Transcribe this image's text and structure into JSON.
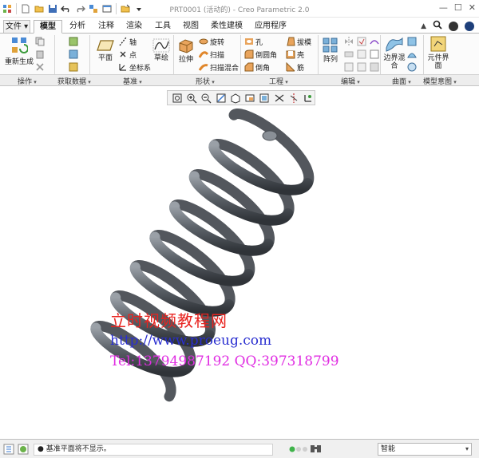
{
  "window": {
    "title": "PRT0001 (活动的) - Creo Parametric 2.0"
  },
  "quick_access": {
    "icons": [
      "new-icon",
      "open-icon",
      "save-icon",
      "undo-icon",
      "redo-icon",
      "regenerate-icon",
      "windows-icon",
      "close-window-icon",
      "customize-icon"
    ]
  },
  "tabs": [
    {
      "label": "文件 ▾"
    },
    {
      "label": "模型"
    },
    {
      "label": "分析"
    },
    {
      "label": "注释"
    },
    {
      "label": "渲染"
    },
    {
      "label": "工具"
    },
    {
      "label": "视图"
    },
    {
      "label": "柔性建模"
    },
    {
      "label": "应用程序"
    }
  ],
  "active_tab": "模型",
  "ribbon": {
    "operations": {
      "regenerate": "重新生成",
      "group": "操作"
    },
    "get_data": {
      "group": "获取数据"
    },
    "datum": {
      "plane": "平面",
      "axis": "轴",
      "point": "点",
      "csys": "坐标系",
      "sketch": "草绘",
      "group": "基准"
    },
    "shapes": {
      "extrude": "拉伸",
      "revolve": "旋转",
      "sweep": "扫描",
      "swept_blend": "扫描混合",
      "group": "形状"
    },
    "engineering": {
      "hole": "孔",
      "round": "倒圆角",
      "chamfer": "倒角",
      "draft": "拔模",
      "shell": "壳",
      "rib": "筋",
      "group": "工程"
    },
    "editing": {
      "pattern": "阵列",
      "group": "编辑"
    },
    "surfaces": {
      "boundary_blend": "边界混合",
      "group": "曲面"
    },
    "model_intent": {
      "component_interface": "元件界面",
      "group": "模型意图"
    }
  },
  "graphics_toolbar": {
    "icons": [
      "refit-icon",
      "zoom-in-icon",
      "zoom-out-icon",
      "repaint-icon",
      "display-style-icon",
      "saved-views-icon",
      "view-manager-icon",
      "plane-display-icon",
      "axis-display-icon",
      "csys-display-icon"
    ]
  },
  "watermark": {
    "line1": "立时视频教程网",
    "line2": "http://www.proeug.com",
    "line3": "Tel:13794987192  QQ:397318799"
  },
  "status": {
    "message": "● 基准平面将不显示。",
    "filter": "智能"
  },
  "colors": {
    "spring": "#6b7178",
    "watermark_red": "#e8231f",
    "watermark_blue": "#2a2fd0",
    "watermark_magenta": "#e02de2"
  }
}
